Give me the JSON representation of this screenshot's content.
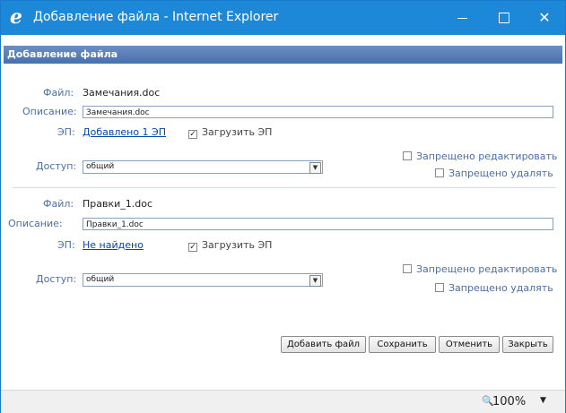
{
  "window": {
    "title": "Добавление файла - Internet Explorer",
    "icon": "ie-logo-icon",
    "controls": {
      "minimize": "—",
      "maximize": "☐",
      "close": "✕"
    },
    "accent": "#1e88d8"
  },
  "dialog": {
    "header": "Добавление файла",
    "header_color": "#5a80b8",
    "labels": {
      "file": "Файл:",
      "description": "Описание:",
      "signature": "ЭП:",
      "access": "Доступ:"
    },
    "files": [
      {
        "file_name": "Замечания.doc",
        "description": "Замечания.doc",
        "signature_link": "Добавлено 1 ЭП",
        "upload_signature": "Загрузить ЭП",
        "upload_checked": true,
        "access": "общий",
        "forbid_edit": "Запрещено редактировать",
        "forbid_delete": "Запрещено удалять"
      },
      {
        "file_name": "Правки_1.doc",
        "description": "Правки_1.doc",
        "signature_link": "Не найдено",
        "upload_signature": "Загрузить ЭП",
        "upload_checked": true,
        "access": "общий",
        "forbid_edit": "Запрещено редактировать",
        "forbid_delete": "Запрещено удалять"
      }
    ],
    "buttons": {
      "add_file": "Добавить файл",
      "save": "Сохранить",
      "cancel": "Отменить",
      "close": "Закрыть"
    }
  },
  "statusbar": {
    "zoom": "100%",
    "zoom_icon": "zoom-magnifier-icon",
    "caret": "▼"
  }
}
